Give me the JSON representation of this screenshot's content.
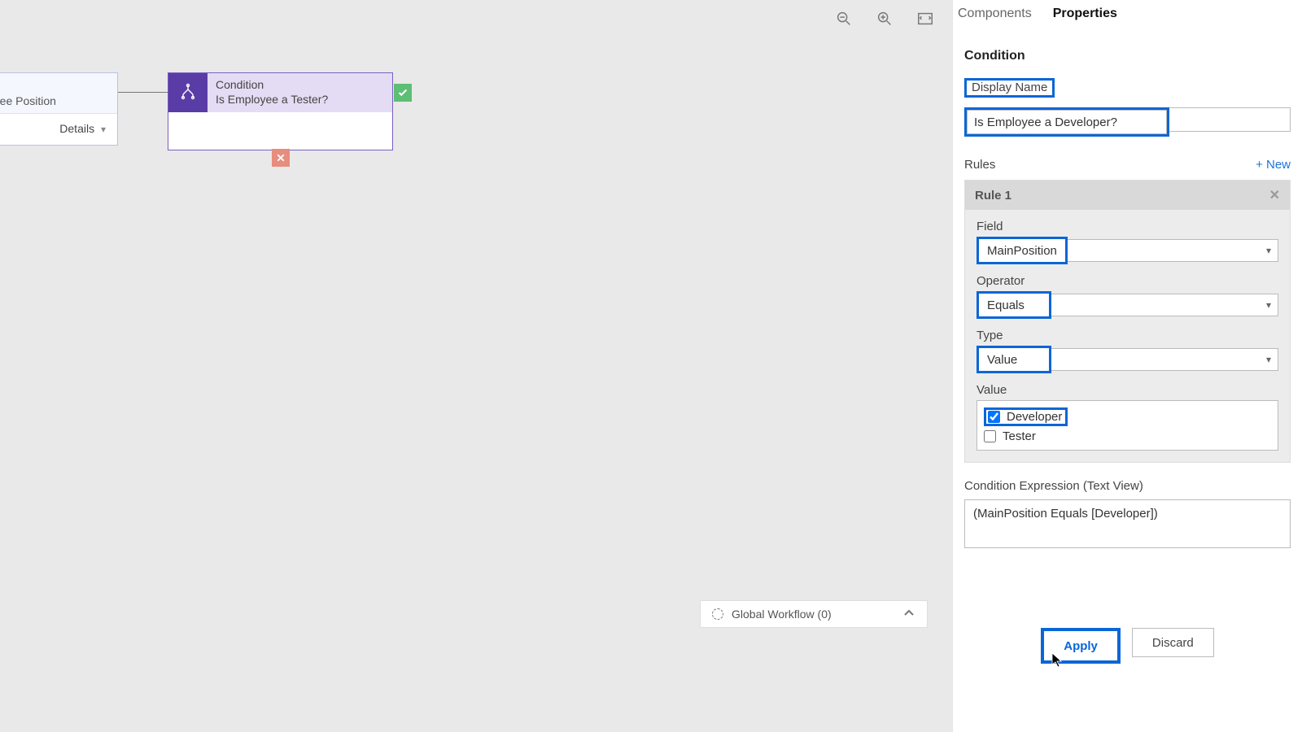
{
  "canvas": {
    "entity_node": {
      "line1": "ee",
      "line2": "Employee Position",
      "details_label": "Details"
    },
    "condition_node": {
      "type_label": "Condition",
      "title": "Is Employee a Tester?"
    },
    "global_workflow_label": "Global Workflow (0)"
  },
  "panel": {
    "tabs": {
      "components": "Components",
      "properties": "Properties"
    },
    "section_title": "Condition",
    "display_name_label": "Display Name",
    "display_name_value": "Is Employee a Developer?",
    "rules_label": "Rules",
    "new_rule_label": "+ New",
    "rule": {
      "title": "Rule 1",
      "field_label": "Field",
      "field_value": "MainPosition",
      "operator_label": "Operator",
      "operator_value": "Equals",
      "type_label": "Type",
      "type_value": "Value",
      "value_label": "Value",
      "options": {
        "developer": "Developer",
        "tester": "Tester"
      }
    },
    "expression_label": "Condition Expression (Text View)",
    "expression_value": "(MainPosition Equals [Developer])",
    "apply_label": "Apply",
    "discard_label": "Discard"
  }
}
